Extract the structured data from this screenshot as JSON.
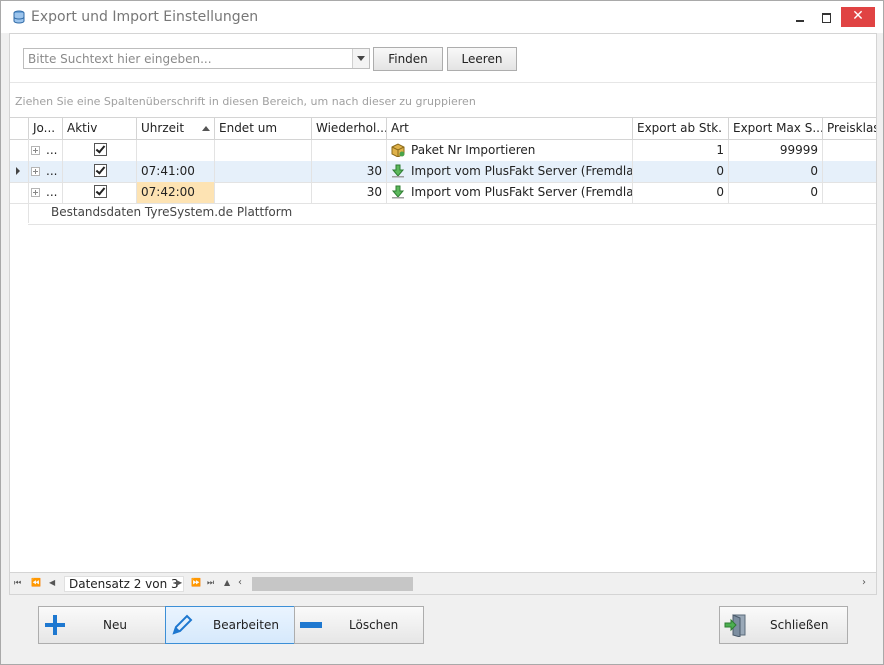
{
  "window": {
    "title": "Export und Import Einstellungen"
  },
  "search": {
    "placeholder": "Bitte Suchtext hier eingeben...",
    "find_label": "Finden",
    "clear_label": "Leeren"
  },
  "group_panel": {
    "text": "Ziehen Sie eine Spaltenüberschrift in diesen Bereich, um nach dieser zu gruppieren"
  },
  "grid": {
    "columns": [
      "Jo...",
      "Aktiv",
      "Uhrzeit",
      "Endet um",
      "Wiederhol...",
      "Art",
      "Export ab Stk.",
      "Export Max S...",
      "Preisklass"
    ],
    "rows": [
      {
        "job": "...",
        "aktiv": true,
        "uhrzeit": "",
        "endet": "",
        "wiederholung": "",
        "art": "Paket Nr Importieren",
        "export_ab": "1",
        "export_max": "99999",
        "art_icon": "package-icon"
      },
      {
        "job": "...",
        "aktiv": true,
        "uhrzeit": "07:41:00",
        "endet": "",
        "wiederholung": "30",
        "art": "Import vom PlusFakt Server (Fremdla...",
        "export_ab": "0",
        "export_max": "0",
        "art_icon": "download-arrow-icon"
      },
      {
        "job": "...",
        "aktiv": true,
        "uhrzeit": "07:42:00",
        "endet": "",
        "wiederholung": "30",
        "art": "Import vom PlusFakt Server (Fremdla...",
        "export_ab": "0",
        "export_max": "0",
        "art_icon": "download-arrow-icon"
      }
    ],
    "selected_row": 2,
    "detail_text": "Bestandsdaten TyreSystem.de Plattform"
  },
  "navigator": {
    "record_text": "Datensatz 2 von 3"
  },
  "buttons": {
    "new": "Neu",
    "edit": "Bearbeiten",
    "delete": "Löschen",
    "close": "Schließen"
  },
  "colors": {
    "accent": "#1e78d0",
    "highlight": "#fde3b3",
    "selected_row": "#e6f0fa",
    "close_button": "#e04343"
  }
}
